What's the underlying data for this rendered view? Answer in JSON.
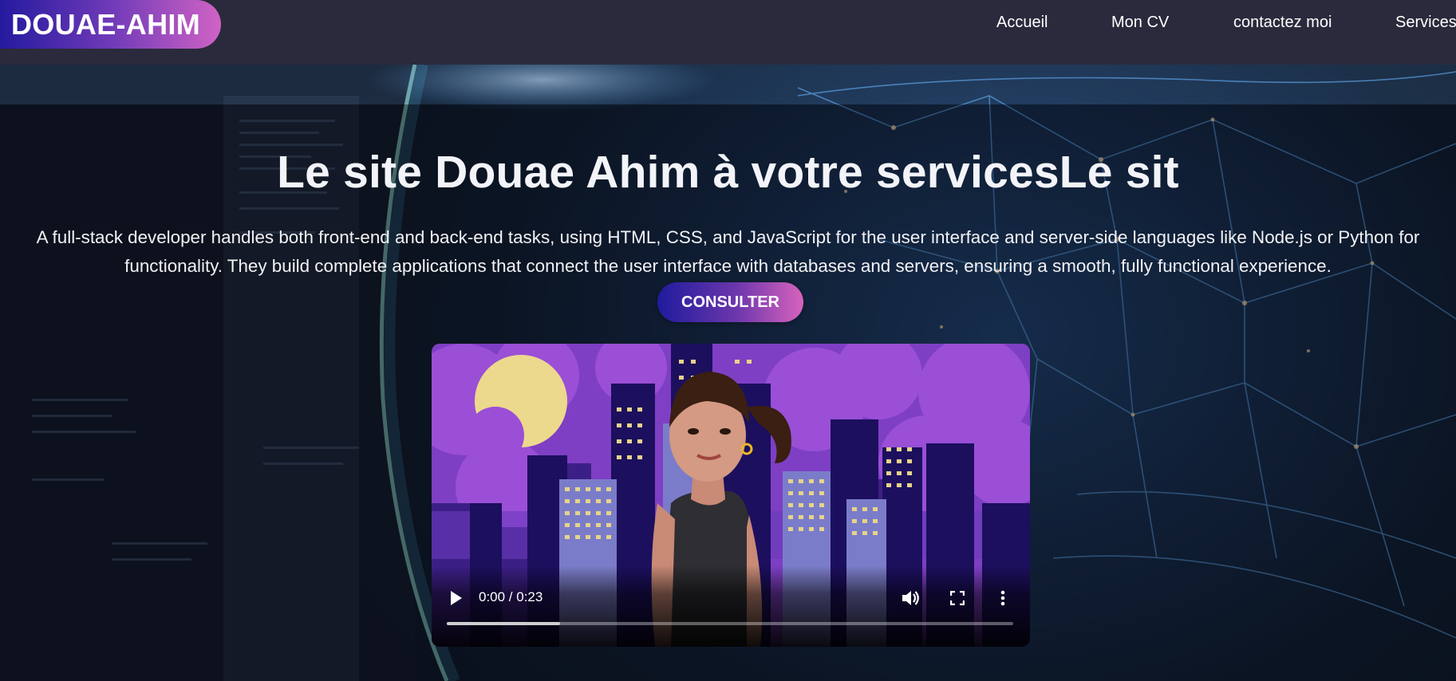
{
  "header": {
    "logo": "DOUAE-AHIM",
    "nav": [
      {
        "label": "Accueil"
      },
      {
        "label": "Mon CV"
      },
      {
        "label": "contactez moi"
      },
      {
        "label": "Services"
      }
    ]
  },
  "hero": {
    "title": "Le site Douae Ahim à votre servicesLe sit",
    "description": "A full-stack developer handles both front-end and back-end tasks, using HTML, CSS, and JavaScript for the user interface and server-side languages like Node.js or Python for functionality. They build complete applications that connect the user interface with databases and servers, ensuring a smooth, fully functional experience.",
    "button": "CONSULTER"
  },
  "video": {
    "time": "0:00 / 0:23",
    "buffered_fraction": 0.2,
    "icons": [
      "play-icon",
      "volume-icon",
      "fullscreen-icon",
      "more-options-icon"
    ]
  },
  "colors": {
    "header_bg": "#2a2a3c",
    "gradient_start": "#241a9e",
    "gradient_mid": "#6f3ab8",
    "gradient_end": "#d063c4",
    "video_sky": "#7e3fc4"
  }
}
